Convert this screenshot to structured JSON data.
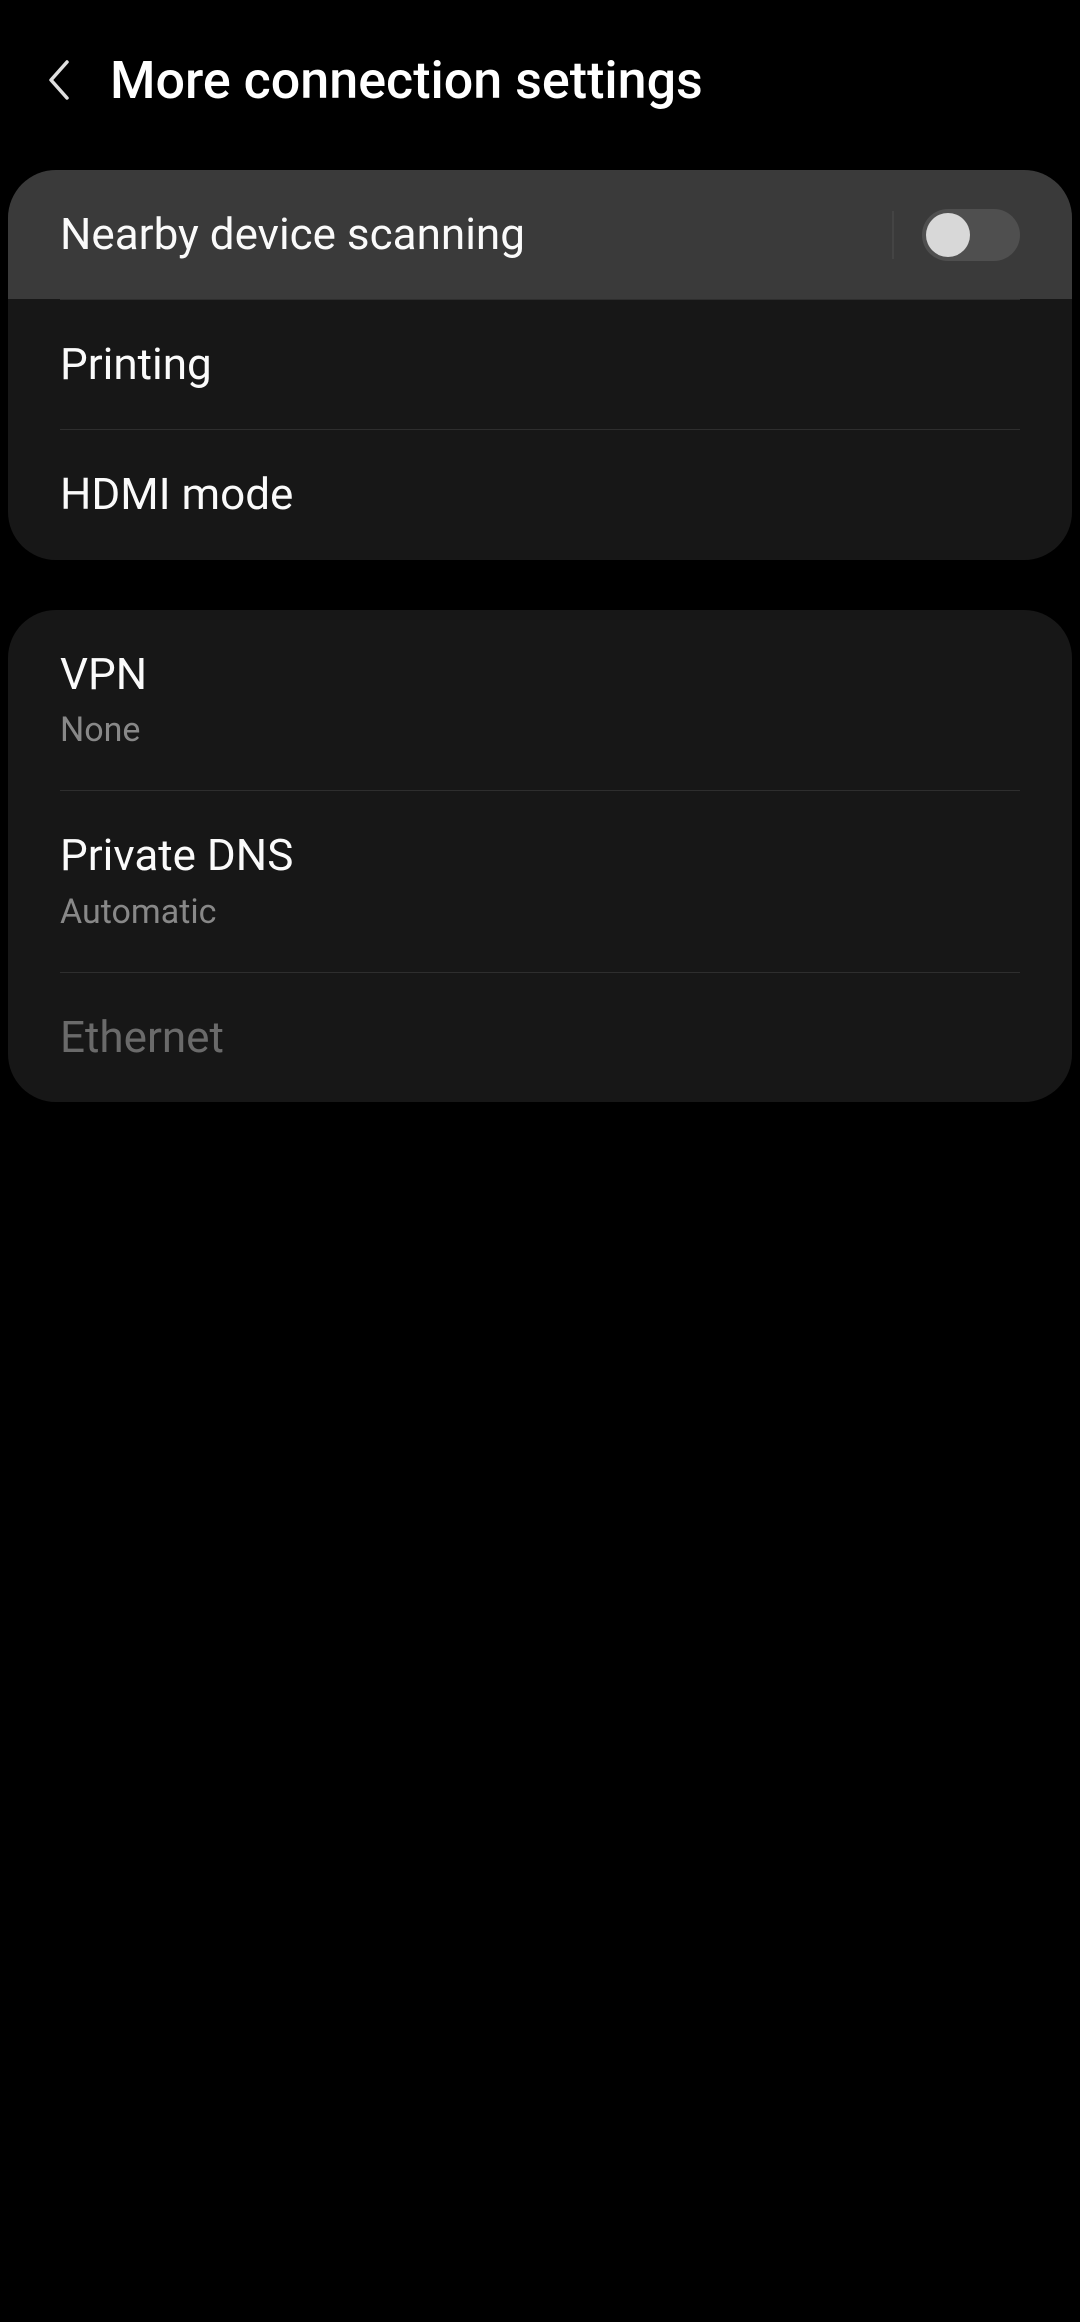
{
  "header": {
    "title": "More connection settings"
  },
  "group1": {
    "nearby": {
      "label": "Nearby device scanning",
      "toggle_state": "off"
    },
    "printing": {
      "label": "Printing"
    },
    "hdmi": {
      "label": "HDMI mode"
    }
  },
  "group2": {
    "vpn": {
      "label": "VPN",
      "sublabel": "None"
    },
    "dns": {
      "label": "Private DNS",
      "sublabel": "Automatic"
    },
    "ethernet": {
      "label": "Ethernet"
    }
  }
}
